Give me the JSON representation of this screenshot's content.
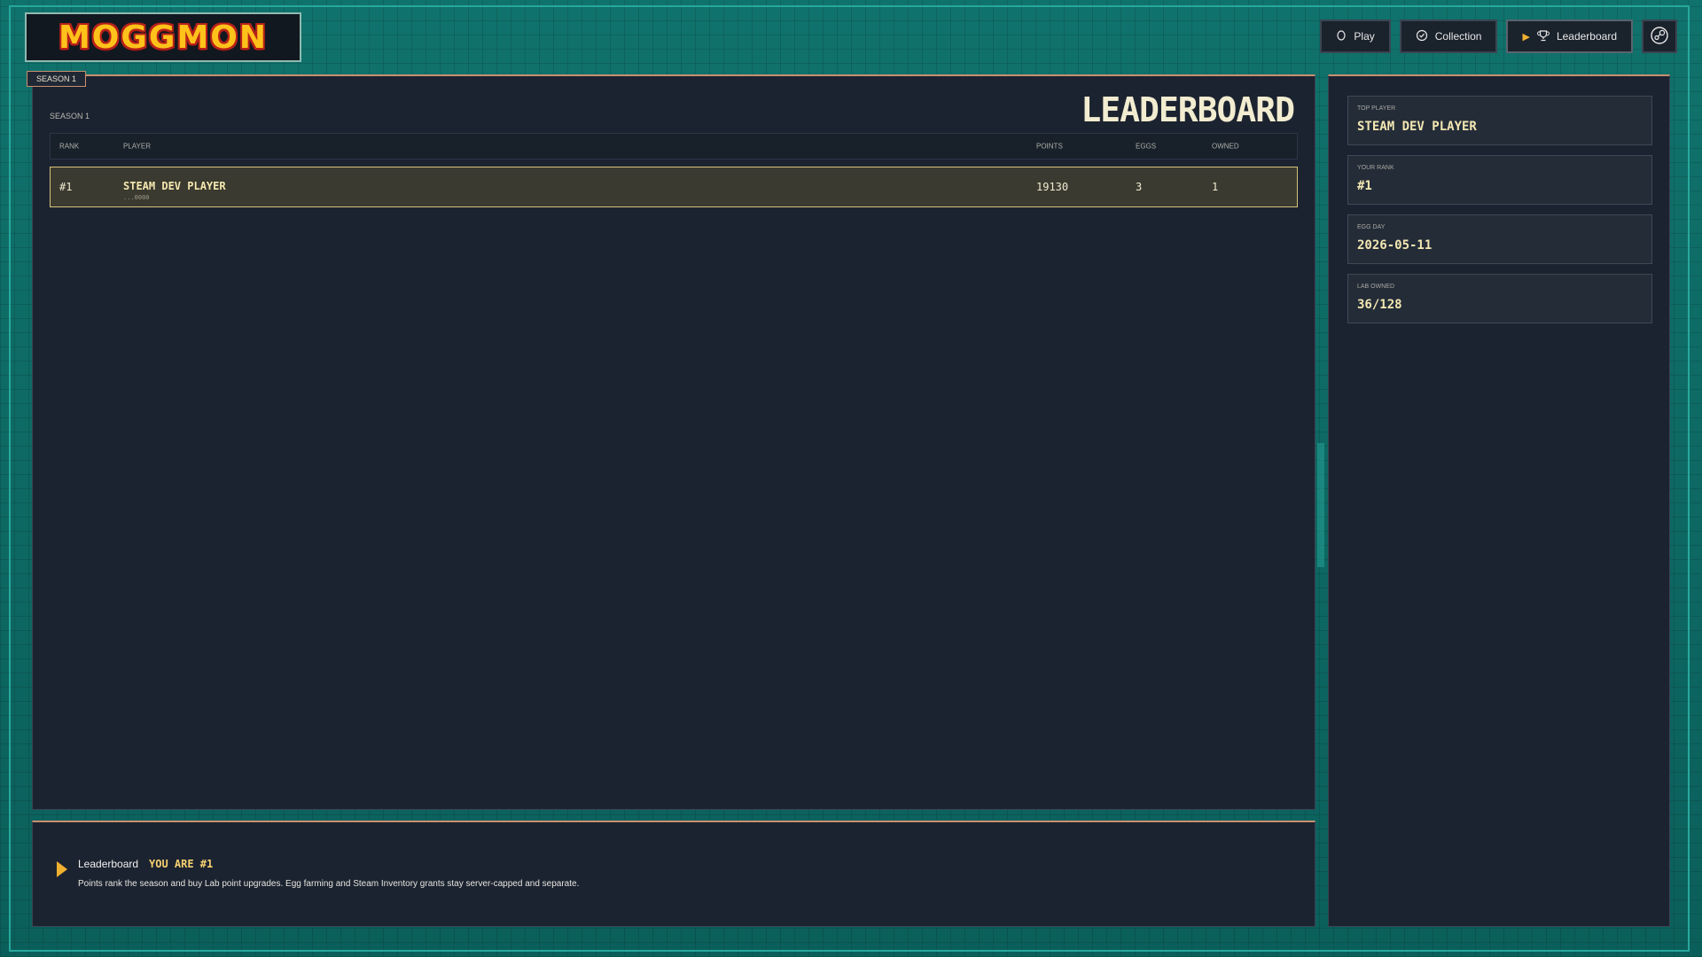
{
  "header": {
    "logo_text": "MOGGMON",
    "nav": [
      {
        "label": "Play",
        "icon": "circle-icon"
      },
      {
        "label": "Collection",
        "icon": "check-circle-icon"
      },
      {
        "label": "Leaderboard",
        "icon": "trophy-icon",
        "active": true
      }
    ],
    "steam_icon": "steam-icon"
  },
  "main": {
    "season_tab": "SEASON 1",
    "season_label": "SEASON 1",
    "title": "LEADERBOARD",
    "columns": {
      "rank": "RANK",
      "player": "PLAYER",
      "points": "POINTS",
      "eggs": "EGGS",
      "owned": "OWNED"
    },
    "rows": [
      {
        "rank": "#1",
        "player": "STEAM DEV PLAYER",
        "sub": "...0000",
        "points": "19130",
        "eggs": "3",
        "owned": "1"
      }
    ]
  },
  "footer": {
    "title": "Leaderboard",
    "rank_text": "YOU ARE #1",
    "description": "Points rank the season and buy Lab point upgrades. Egg farming and Steam Inventory grants stay server-capped and separate."
  },
  "side": {
    "stats": [
      {
        "label": "TOP PLAYER",
        "value": "STEAM DEV PLAYER"
      },
      {
        "label": "YOUR RANK",
        "value": "#1"
      },
      {
        "label": "EGG DAY",
        "value": "2026-05-11"
      },
      {
        "label": "LAB OWNED",
        "value": "36/128"
      }
    ]
  },
  "colors": {
    "accent": "#f0b030",
    "teal": "#0e6b66",
    "panel": "#1c2330",
    "highlight_row": "#3a3a30"
  }
}
